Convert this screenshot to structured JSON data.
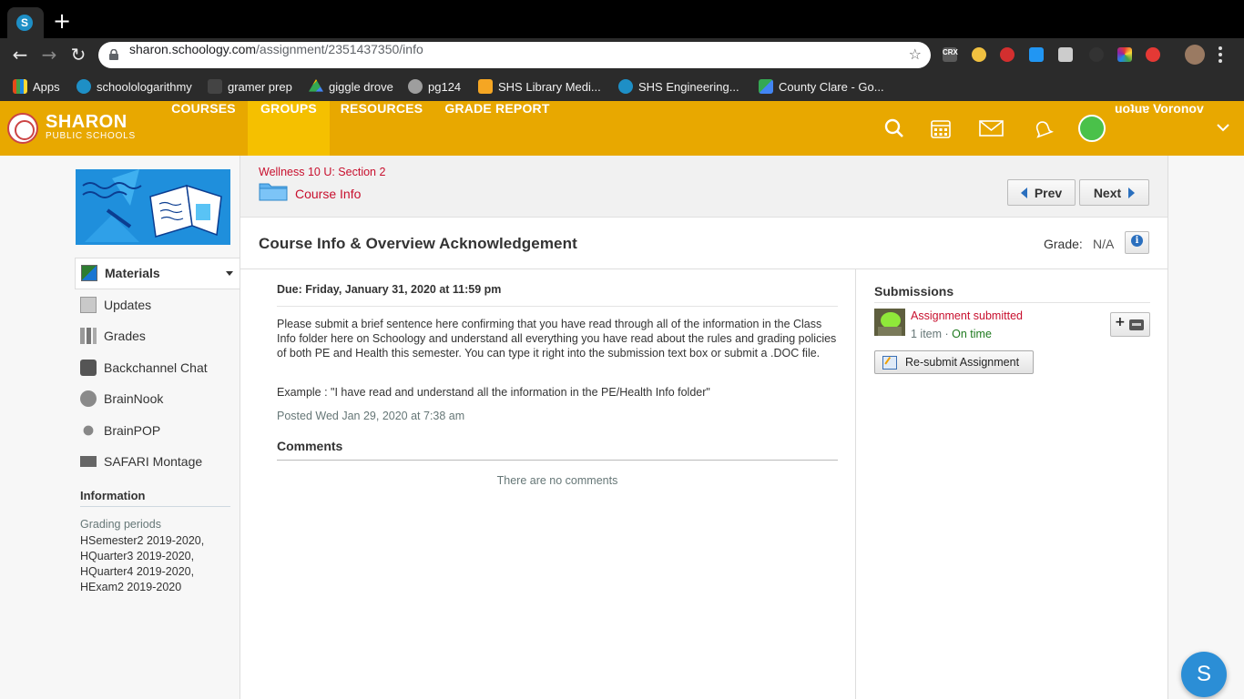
{
  "browser": {
    "tab_favicon_letter": "S",
    "new_tab": "+",
    "url_host": "sharon.schoology.com",
    "url_path": "/assignment/2351437350/info",
    "bookmarks": [
      {
        "label": "Apps",
        "icon": "apps-grid-icon",
        "color": "#e64a19"
      },
      {
        "label": "schoolologarithmy",
        "icon": "schoology-icon",
        "color": "#1e8fc6"
      },
      {
        "label": "gramer prep",
        "icon": "gb-icon",
        "color": "#444444"
      },
      {
        "label": "giggle drove",
        "icon": "drive-icon",
        "color": "#f4b400"
      },
      {
        "label": "pg124",
        "icon": "globe-icon",
        "color": "#9e9e9e"
      },
      {
        "label": "SHS Library Medi...",
        "icon": "library-icon",
        "color": "#f5a623"
      },
      {
        "label": "SHS Engineering...",
        "icon": "schoology-icon",
        "color": "#1e8fc6"
      },
      {
        "label": "County Clare - Go...",
        "icon": "maps-icon",
        "color": "#34a853"
      }
    ]
  },
  "header": {
    "logo_big": "SHARON",
    "logo_small": "PUBLIC SCHOOLS",
    "nav": [
      {
        "label": "COURSES",
        "active": false
      },
      {
        "label": "GROUPS",
        "active": true
      },
      {
        "label": "RESOURCES",
        "active": false
      },
      {
        "label": "GRADE REPORT",
        "active": false
      }
    ],
    "username": "uoʇuɐ Voronov",
    "accent": "#e8a800",
    "active_accent": "#f5c000"
  },
  "sidebar": {
    "items": [
      {
        "label": "Materials",
        "icon": "materials-icon"
      },
      {
        "label": "Updates",
        "icon": "updates-icon"
      },
      {
        "label": "Grades",
        "icon": "grades-icon"
      },
      {
        "label": "Backchannel Chat",
        "icon": "chat-icon"
      },
      {
        "label": "BrainNook",
        "icon": "brainnook-icon"
      },
      {
        "label": "BrainPOP",
        "icon": "brainpop-icon"
      },
      {
        "label": "SAFARI Montage",
        "icon": "safari-montage-icon"
      }
    ],
    "info_title": "Information",
    "grading_label": "Grading periods",
    "grading_periods": [
      "HSemester2 2019-2020,",
      "HQuarter3 2019-2020,",
      "HQuarter4 2019-2020,",
      "HExam2 2019-2020"
    ]
  },
  "main": {
    "course_crumb": "Wellness 10 U: Section 2",
    "folder_crumb": "Course Info",
    "prev_label": "Prev",
    "next_label": "Next",
    "title": "Course Info & Overview Acknowledgement",
    "grade_label": "Grade:",
    "grade_value": "N/A",
    "due": "Due: Friday, January 31, 2020 at 11:59 pm",
    "description": "Please submit a brief sentence here confirming that you have read through all of the information in the Class Info folder here on Schoology and understand all everything you have read about the rules and grading policies of both PE and Health this semester. You can type it right into the submission text box or submit a .DOC file.",
    "example": "Example : \"I have read and understand all the information in the PE/Health Info folder\"",
    "posted": "Posted Wed Jan 29, 2020 at 7:38 am",
    "comments_title": "Comments",
    "no_comments": "There are no comments"
  },
  "submissions": {
    "title": "Submissions",
    "status": "Assignment submitted",
    "items": "1 item",
    "separator": " · ",
    "timeliness": "On time",
    "resubmit_label": "Re-submit Assignment"
  },
  "help_letter": "S"
}
